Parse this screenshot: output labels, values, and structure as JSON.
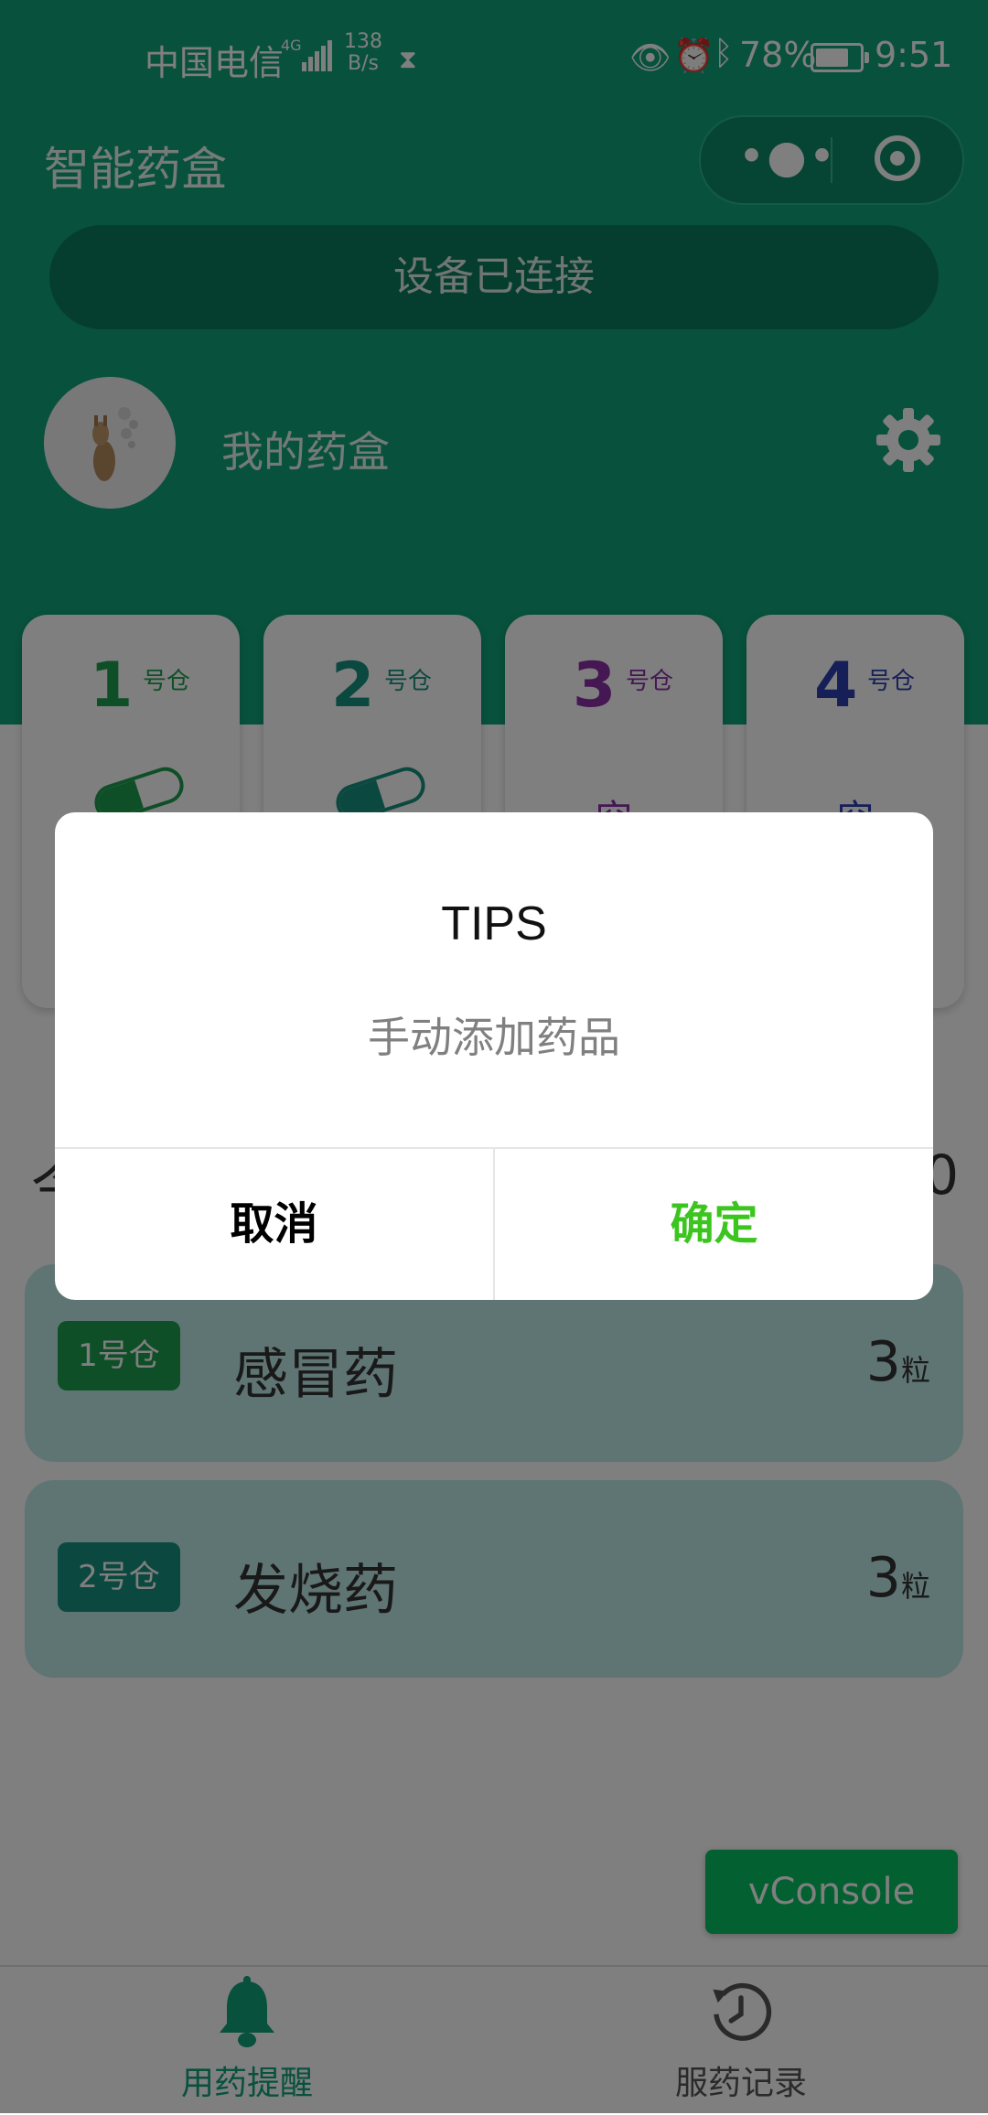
{
  "status_bar": {
    "carrier": "中国电信",
    "network": "4G",
    "speed_value": "138",
    "speed_unit": "B/s",
    "battery": "78%",
    "battery_level": 0.78,
    "time": "9:51"
  },
  "nav": {
    "title": "智能药盒",
    "more_glyph": "•●•"
  },
  "connection": {
    "label": "设备已连接"
  },
  "profile": {
    "name": "我的药盒"
  },
  "bins": [
    {
      "number": "1",
      "unit": "号仓",
      "state": "pill",
      "color": "#1e9e4f"
    },
    {
      "number": "2",
      "unit": "号仓",
      "state": "pill",
      "color": "#17917f"
    },
    {
      "number": "3",
      "unit": "号仓",
      "state": "空",
      "color": "#8a2fa6"
    },
    {
      "number": "4",
      "unit": "号仓",
      "state": "空",
      "color": "#2c3fb0"
    }
  ],
  "summary": {
    "left": "今",
    "right": "0"
  },
  "medicines": [
    {
      "tag": "1号仓",
      "name": "感冒药",
      "count": "3",
      "unit": "粒",
      "card_color": "#bfeae6",
      "tag_color": "#1e9e4f"
    },
    {
      "tag": "2号仓",
      "name": "发烧药",
      "count": "3",
      "unit": "粒",
      "card_color": "#bfeae6",
      "tag_color": "#17917f"
    }
  ],
  "vconsole": {
    "label": "vConsole"
  },
  "tabbar": {
    "reminder_label": "用药提醒",
    "history_label": "服药记录",
    "active_color": "#10a37a"
  },
  "dialog": {
    "title": "TIPS",
    "message": "手动添加药品",
    "cancel_label": "取消",
    "confirm_label": "确定"
  }
}
